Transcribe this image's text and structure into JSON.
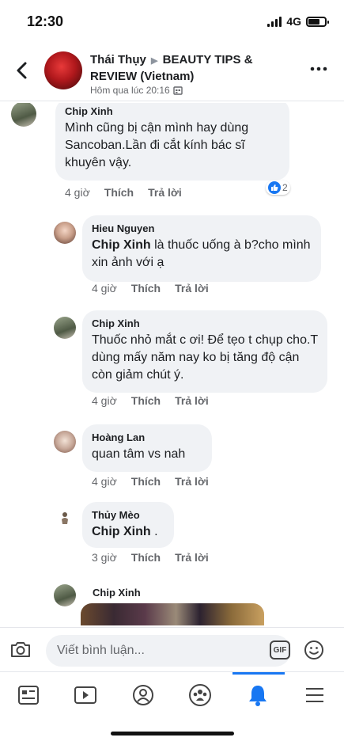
{
  "status_bar": {
    "time": "12:30",
    "network": "4G"
  },
  "header": {
    "author": "Thái Thụy",
    "group": "BEAUTY TIPS & REVIEW (Vietnam)",
    "timestamp": "Hôm qua lúc 20:16"
  },
  "comments": [
    {
      "name": "Chip Xinh",
      "text": "Mình cũng bị cận mình hay dùng Sancoban.Lần đi cắt kính bác sĩ khuyên vậy.",
      "time": "4 giờ",
      "like": "Thích",
      "reply": "Trả lời",
      "reaction_count": "2"
    },
    {
      "name": "Hieu Nguyen",
      "mention": "Chip Xinh",
      "text": " là thuốc uống à b?cho mình xin ảnh với ạ",
      "time": "4 giờ",
      "like": "Thích",
      "reply": "Trả lời"
    },
    {
      "name": "Chip Xinh",
      "text": "Thuốc nhỏ mắt c ơi! Để tẹo t chụp cho.T dùng mấy năm nay ko bị tăng độ cận còn giảm chút ý.",
      "time": "4 giờ",
      "like": "Thích",
      "reply": "Trả lời"
    },
    {
      "name": "Hoàng Lan",
      "text": "quan tâm vs nah",
      "time": "4 giờ",
      "like": "Thích",
      "reply": "Trả lời"
    },
    {
      "name": "Thủy Mèo",
      "mention": "Chip Xinh",
      "text": " .",
      "time": "3 giờ",
      "like": "Thích",
      "reply": "Trả lời"
    },
    {
      "name": "Chip Xinh"
    }
  ],
  "composer": {
    "placeholder": "Viết bình luận...",
    "gif_label": "GIF"
  },
  "tabs": [
    {
      "icon": "news-feed-icon"
    },
    {
      "icon": "video-icon"
    },
    {
      "icon": "profile-icon"
    },
    {
      "icon": "groups-icon"
    },
    {
      "icon": "notifications-icon",
      "active": true
    },
    {
      "icon": "menu-icon"
    }
  ],
  "colors": {
    "accent": "#1877f2",
    "bubble": "#f0f2f5",
    "meta_text": "#65676b"
  }
}
